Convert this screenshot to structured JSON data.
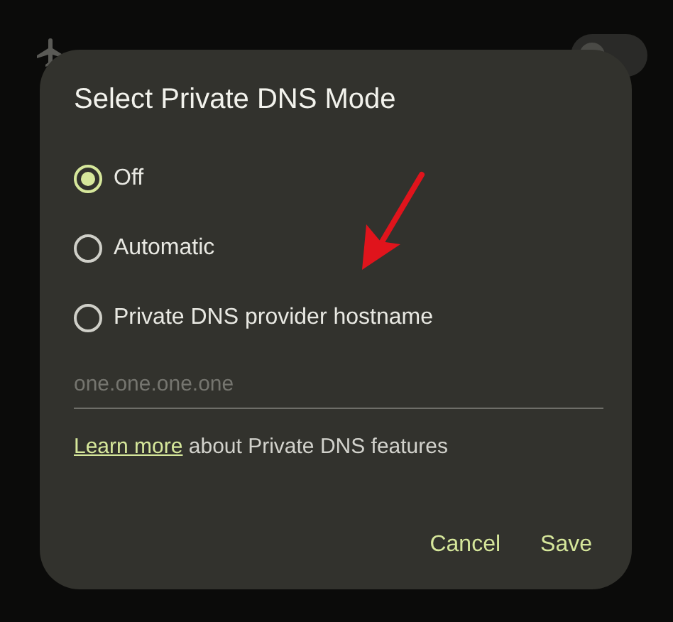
{
  "background_settings": {
    "airplane_mode": {
      "on": false
    }
  },
  "dialog": {
    "title": "Select Private DNS Mode",
    "options": [
      {
        "label": "Off",
        "selected": true
      },
      {
        "label": "Automatic",
        "selected": false
      },
      {
        "label": "Private DNS provider hostname",
        "selected": false
      }
    ],
    "hostname_field": {
      "placeholder": "one.one.one.one"
    },
    "info": {
      "link": "Learn more",
      "text": "about Private DNS features"
    },
    "buttons": [
      "Cancel",
      "Save"
    ]
  }
}
